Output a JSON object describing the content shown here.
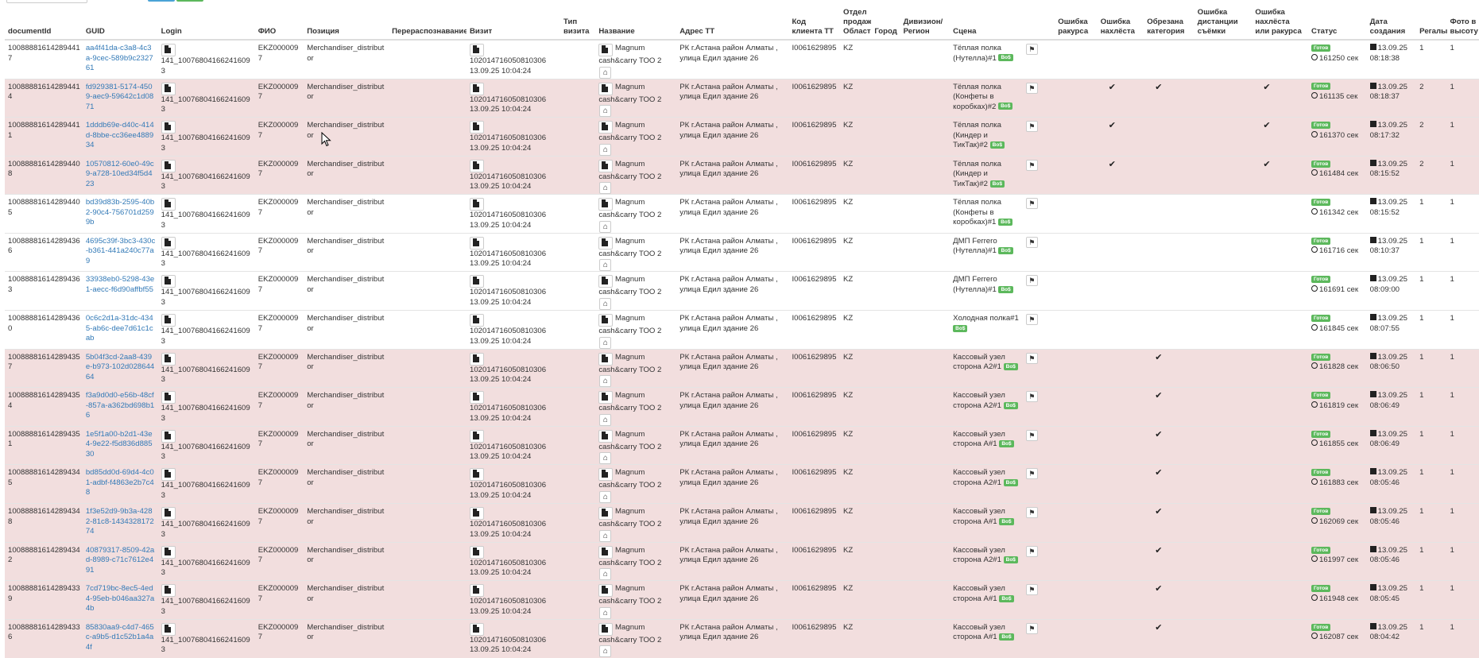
{
  "columns": [
    {
      "key": "documentId",
      "label": "documentId"
    },
    {
      "key": "guid",
      "label": "GUID"
    },
    {
      "key": "login",
      "label": "Login"
    },
    {
      "key": "fio",
      "label": "ФИО"
    },
    {
      "key": "position",
      "label": "Позиция"
    },
    {
      "key": "redistribution",
      "label": "Перераспознавание"
    },
    {
      "key": "visit",
      "label": "Визит"
    },
    {
      "key": "visit_type",
      "label": "Тип визита"
    },
    {
      "key": "name",
      "label": "Название"
    },
    {
      "key": "address",
      "label": "Адрес ТТ"
    },
    {
      "key": "client_code",
      "label": "Код клиента ТТ"
    },
    {
      "key": "sales_dept",
      "label": "Отдел продаж/ Область"
    },
    {
      "key": "city",
      "label": "Город"
    },
    {
      "key": "division",
      "label": "Дивизион/ Регион"
    },
    {
      "key": "scene",
      "label": "Сцена"
    },
    {
      "key": "flag",
      "label": ""
    },
    {
      "key": "angle_error",
      "label": "Ошибка ракурса"
    },
    {
      "key": "overlap_error",
      "label": "Ошибка нахлёста"
    },
    {
      "key": "cropped_category",
      "label": "Обрезана категория"
    },
    {
      "key": "distance_error",
      "label": "Ошибка дистанции съёмки"
    },
    {
      "key": "overlap_angle_error",
      "label": "Ошибка нахлёста или ракурса"
    },
    {
      "key": "status",
      "label": "Статус"
    },
    {
      "key": "created",
      "label": "Дата создания"
    },
    {
      "key": "shelves",
      "label": "Регалы"
    },
    {
      "key": "photo_height",
      "label": "Фото в высоту"
    }
  ],
  "common": {
    "login_value": "141_100768041662416093",
    "fio_value": "EKZ0000097",
    "position_value": "Merchandiser_distributor",
    "visit_id": "102014716050810306",
    "visit_datetime": "13.09.25 10:04:24",
    "name_value": "Magnum cash&carry ТОО 2",
    "address_value": "РК г.Астана район Алматы , улица Едил здание 26",
    "client_code_value": "I0061629895",
    "sales_dept_value": "KZ",
    "status_badge": "Готов",
    "created_date": "13.09.25",
    "tag_label": "Bo$"
  },
  "rows": [
    {
      "bg": "white",
      "documentId": "10088881614289441​7",
      "guid": "aa4f41da-c3a8-4c3a-9cec-589b9c232761",
      "scene": "Тёплая полка (Нутелла)#1",
      "overlap": false,
      "cropped": false,
      "overlap_angle": false,
      "seconds": "161250 сек",
      "time": "08:18:38",
      "shelves": "1",
      "photo_height": "1"
    },
    {
      "bg": "pink",
      "documentId": "100888816142894414",
      "guid": "fd929381-5174-4509-aec9-59642c1d0871",
      "scene": "Тёплая полка (Конфеты в коробках)#2",
      "overlap": true,
      "cropped": true,
      "overlap_angle": true,
      "seconds": "161135 сек",
      "time": "08:18:37",
      "shelves": "2",
      "photo_height": "1"
    },
    {
      "bg": "pink",
      "documentId": "100888816142894411",
      "guid": "1dddb69e-d40c-414d-8bbe-cc36ee488934",
      "scene": "Тёплая полка (Киндер и ТикТак)#2",
      "overlap": true,
      "cropped": false,
      "overlap_angle": true,
      "seconds": "161370 сек",
      "time": "08:17:32",
      "shelves": "2",
      "photo_height": "1"
    },
    {
      "bg": "pink",
      "documentId": "100888816142894408",
      "guid": "10570812-60e0-49c9-a728-10ed34f5d423",
      "scene": "Тёплая полка (Киндер и ТикТак)#2",
      "overlap": true,
      "cropped": false,
      "overlap_angle": true,
      "seconds": "161484 сек",
      "time": "08:15:52",
      "shelves": "2",
      "photo_height": "1"
    },
    {
      "bg": "white",
      "documentId": "100888816142894405",
      "guid": "bd39d83b-2595-40b2-90c4-756701d2599b",
      "scene": "Тёплая полка (Конфеты в коробках)#1",
      "overlap": false,
      "cropped": false,
      "overlap_angle": false,
      "seconds": "161342 сек",
      "time": "08:15:52",
      "shelves": "1",
      "photo_height": "1"
    },
    {
      "bg": "white",
      "documentId": "100888816142894366",
      "guid": "4695c39f-3bc3-430c-b361-441a240c77a9",
      "scene": "ДМП Ferrero (Нутелла)#1",
      "overlap": false,
      "cropped": false,
      "overlap_angle": false,
      "seconds": "161716 сек",
      "time": "08:10:37",
      "shelves": "1",
      "photo_height": "1"
    },
    {
      "bg": "white",
      "documentId": "100888816142894363",
      "guid": "33938eb0-5298-43e1-aecc-f6d90affbf55",
      "scene": "ДМП Ferrero (Нутелла)#1",
      "overlap": false,
      "cropped": false,
      "overlap_angle": false,
      "seconds": "161691 сек",
      "time": "08:09:00",
      "shelves": "1",
      "photo_height": "1"
    },
    {
      "bg": "white",
      "documentId": "100888816142894360",
      "guid": "0c6c2d1a-31dc-4345-ab6c-dee7d61c1cab",
      "scene": "Холодная полка#1",
      "overlap": false,
      "cropped": false,
      "overlap_angle": false,
      "seconds": "161845 сек",
      "time": "08:07:55",
      "shelves": "1",
      "photo_height": "1"
    },
    {
      "bg": "pink",
      "documentId": "100888816142894357",
      "guid": "5b04f3cd-2aa8-439e-b973-102d02864464",
      "scene": "Кассовый узел сторона A2#1",
      "overlap": false,
      "cropped": true,
      "overlap_angle": false,
      "seconds": "161828 сек",
      "time": "08:06:50",
      "shelves": "1",
      "photo_height": "1"
    },
    {
      "bg": "pink",
      "documentId": "100888816142894354",
      "guid": "f3a9d0d0-e56b-48cf-857a-a362bd698b16",
      "scene": "Кассовый узел сторона A2#1",
      "overlap": false,
      "cropped": true,
      "overlap_angle": false,
      "seconds": "161819 сек",
      "time": "08:06:49",
      "shelves": "1",
      "photo_height": "1"
    },
    {
      "bg": "pink",
      "documentId": "100888816142894351",
      "guid": "1e5f1a00-b2d1-43e4-9e22-f5d836d88530",
      "scene": "Кассовый узел сторона A#1",
      "overlap": false,
      "cropped": true,
      "overlap_angle": false,
      "seconds": "161855 сек",
      "time": "08:06:49",
      "shelves": "1",
      "photo_height": "1"
    },
    {
      "bg": "pink",
      "documentId": "100888816142894345",
      "guid": "bd85dd0d-69d4-4c01-adbf-f4863e2b7c48",
      "scene": "Кассовый узел сторона A2#1",
      "overlap": false,
      "cropped": true,
      "overlap_angle": false,
      "seconds": "161883 сек",
      "time": "08:05:46",
      "shelves": "1",
      "photo_height": "1"
    },
    {
      "bg": "pink",
      "documentId": "100888816142894348",
      "guid": "1f3e52d9-9b3a-4282-81c8-143432817274",
      "scene": "Кассовый узел сторона A#1",
      "overlap": false,
      "cropped": true,
      "overlap_angle": false,
      "seconds": "162069 сек",
      "time": "08:05:46",
      "shelves": "1",
      "photo_height": "1"
    },
    {
      "bg": "pink",
      "documentId": "100888816142894342",
      "guid": "40879317-8509-42ad-8989-c71c7612e491",
      "scene": "Кассовый узел сторона A2#1",
      "overlap": false,
      "cropped": true,
      "overlap_angle": false,
      "seconds": "161997 сек",
      "time": "08:05:46",
      "shelves": "1",
      "photo_height": "1"
    },
    {
      "bg": "pink",
      "documentId": "100888816142894339",
      "guid": "7cd719bc-8ec5-4ed4-95eb-b046aa327a4b",
      "scene": "Кассовый узел сторона A#1",
      "overlap": false,
      "cropped": true,
      "overlap_angle": false,
      "seconds": "161948 сек",
      "time": "08:05:45",
      "shelves": "1",
      "photo_height": "1"
    },
    {
      "bg": "pink",
      "documentId": "100888816142894336",
      "guid": "85830aa9-c4d7-465c-a9b5-d1c52b1a4a4f",
      "scene": "Кассовый узел сторона A#1",
      "overlap": false,
      "cropped": true,
      "overlap_angle": false,
      "seconds": "162087 сек",
      "time": "08:04:42",
      "shelves": "1",
      "photo_height": "1"
    }
  ]
}
